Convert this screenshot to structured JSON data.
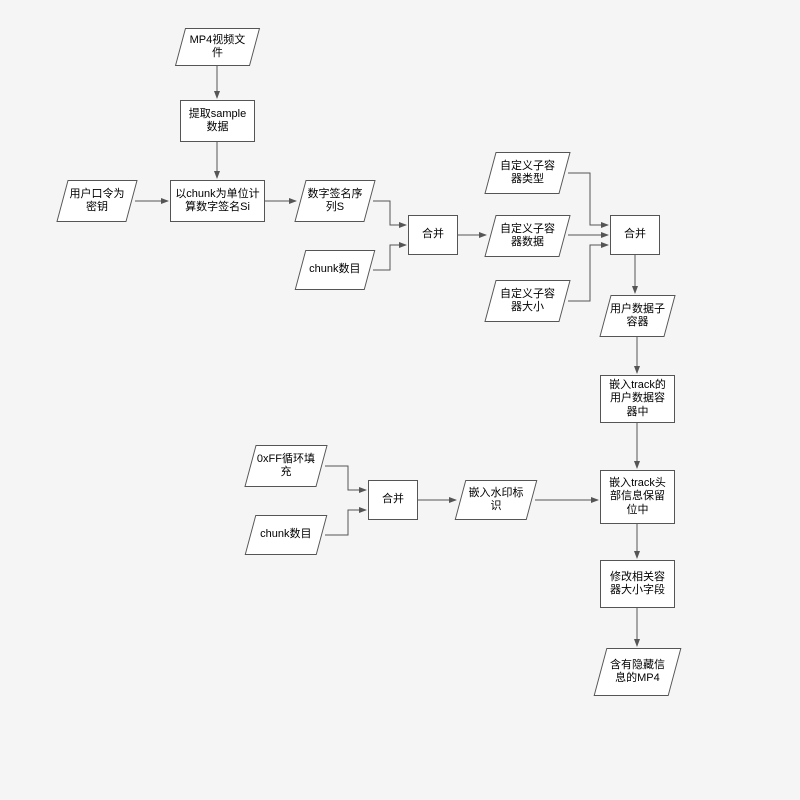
{
  "nodes": {
    "mp4_input": "MP4视频文件",
    "extract": "提取sample数据",
    "user_key": "用户口令为密钥",
    "calc_sig": "以chunk为单位计算数字签名Si",
    "sig_seq": "数字签名序列S",
    "chunk_count1": "chunk数目",
    "merge1": "合并",
    "custom_type": "自定义子容器类型",
    "custom_data": "自定义子容器数据",
    "custom_size": "自定义子容器大小",
    "merge2": "合并",
    "user_box": "用户数据子容器",
    "embed_track": "嵌入track的用户数据容器中",
    "fill_0xff": "0xFF循环填充",
    "chunk_count2": "chunk数目",
    "merge3": "合并",
    "embed_mark": "嵌入水印标识",
    "embed_head": "嵌入track头部信息保留位中",
    "modify_size": "修改相关容器大小字段",
    "output_mp4": "含有隐藏信息的MP4"
  }
}
